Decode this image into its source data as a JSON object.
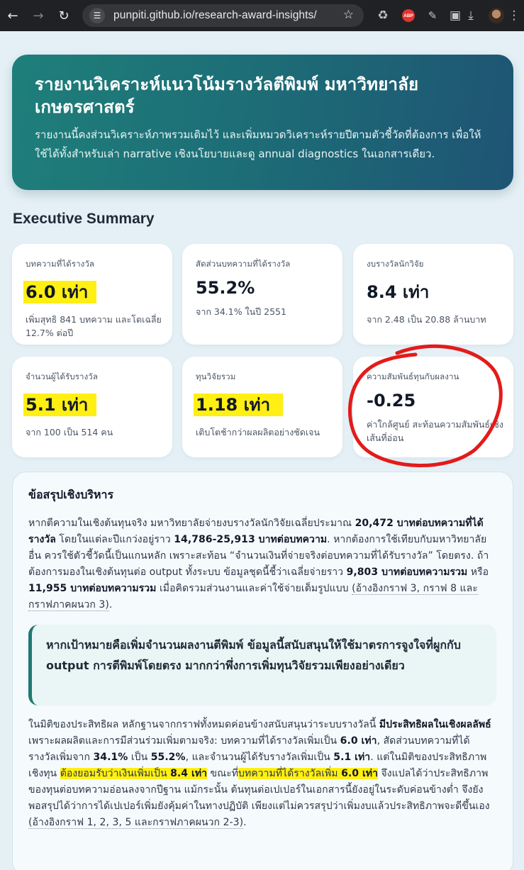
{
  "browser": {
    "url": "punpiti.github.io/research-award-insights/",
    "abp_badge": "ABP"
  },
  "hero": {
    "title": "รายงานวิเคราะห์แนวโน้มรางวัลตีพิมพ์ มหาวิทยาลัยเกษตรศาสตร์",
    "subtitle": "รายงานนี้คงส่วนวิเคราะห์ภาพรวมเดิมไว้ และเพิ่มหมวดวิเคราะห์รายปีตามตัวชี้วัดที่ต้องการ เพื่อให้ใช้ได้ทั้งสำหรับเล่า narrative เชิงนโยบายและดู annual diagnostics ในเอกสารเดียว."
  },
  "section_title": "Executive Summary",
  "cards": [
    {
      "label": "บทความที่ได้รางวัล",
      "value": "6.0 เท่า",
      "sub": "เพิ่มสุทธิ 841 บทความ และโตเฉลี่ย 12.7% ต่อปี",
      "highlighted": true
    },
    {
      "label": "สัดส่วนบทความที่ได้รางวัล",
      "value": "55.2%",
      "sub": "จาก 34.1% ในปี 2551",
      "highlighted": false
    },
    {
      "label": "งบรางวัลนักวิจัย",
      "value": "8.4 เท่า",
      "sub": "จาก 2.48 เป็น 20.88 ล้านบาท",
      "highlighted": false
    },
    {
      "label": "จำนวนผู้ได้รับรางวัล",
      "value": "5.1 เท่า",
      "sub": "จาก 100 เป็น 514 คน",
      "highlighted": true
    },
    {
      "label": "ทุนวิจัยรวม",
      "value": "1.18 เท่า",
      "sub": "เติบโตช้ากว่าผลผลิตอย่างชัดเจน",
      "highlighted": true
    },
    {
      "label": "ความสัมพันธ์ทุนกับผลงาน",
      "value": "-0.25",
      "sub": "ค่าใกล้ศูนย์ สะท้อนความสัมพันธ์เชิงเส้นที่อ่อน",
      "highlighted": false
    }
  ],
  "summary": {
    "heading": "ข้อสรุปเชิงบริหาร",
    "p1": {
      "a": "หากตีความในเชิงต้นทุนจริง มหาวิทยาลัยจ่ายงบรางวัลนักวิจัยเฉลี่ยประมาณ ",
      "b": "20,472 บาทต่อบทความที่ได้รางวัล",
      "c": " โดยในแต่ละปีแกว่งอยู่ราว ",
      "d": "14,786-25,913 บาทต่อบทความ",
      "e": ". หากต้องการใช้เทียบกับมหาวิทยาลัยอื่น ควรใช้ตัวชี้วัดนี้เป็นแกนหลัก เพราะสะท้อน “จำนวนเงินที่จ่ายจริงต่อบทความที่ได้รับรางวัล” โดยตรง. ถ้าต้องการมองในเชิงต้นทุนต่อ output ทั้งระบบ ข้อมูลชุดนี้ชี้ว่าเฉลี่ยจ่ายราว ",
      "f": "9,803 บาทต่อบทความรวม",
      "g": " หรือ ",
      "h": "11,955 บาทต่อบทความรวม",
      "i": " เมื่อคิดรวมส่วนงานและค่าใช้จ่ายเต็มรูปแบบ ",
      "ref": "(อ้างอิงกราฟ 3, กราฟ 8 และกราฟภาคผนวก 3)",
      "end": "."
    },
    "callout": "หากเป้าหมายคือเพิ่มจำนวนผลงานตีพิมพ์ ข้อมูลนี้สนับสนุนให้ใช้มาตรการจูงใจที่ผูกกับ output การตีพิมพ์โดยตรง มากกว่าพึ่งการเพิ่มทุนวิจัยรวมเพียงอย่างเดียว",
    "p2": {
      "a": "ในมิติของประสิทธิผล หลักฐานจากกราฟทั้งหมดค่อนข้างสนับสนุนว่าระบบรางวัลนี้ ",
      "b": "มีประสิทธิผลในเชิงผลลัพธ์",
      "c": " เพราะผลผลิตและการมีส่วนร่วมเพิ่มตามจริง: บทความที่ได้รางวัลเพิ่มเป็น ",
      "d": "6.0 เท่า",
      "e": ", สัดส่วนบทความที่ได้รางวัลเพิ่มจาก ",
      "f": "34.1%",
      "g": " เป็น ",
      "h": "55.2%",
      "i": ", และจำนวนผู้ได้รับรางวัลเพิ่มเป็น ",
      "j": "5.1 เท่า",
      "k": ". แต่ในมิติของประสิทธิภาพเชิงทุน ",
      "l": "ต้องยอมรับว่าเงินเพิ่มเป็น ",
      "m": "8.4 เท่า",
      "n": " ขณะที่",
      "o": "บทความที่ได้รางวัลเพิ่ม ",
      "p": "6.0 เท่า",
      "q": " จึงแปลได้ว่าประสิทธิภาพของทุนต่อบทความอ่อนลงจากปีฐาน แม้กระนั้น ต้นทุนต่อเปเปอร์ในเอกสารนี้ยังอยู่ในระดับค่อนข้างต่ำ จึงยังพอสรุปได้ว่าการได้เปเปอร์เพิ่มยังคุ้มค่าในทางปฏิบัติ เพียงแต่ไม่ควรสรุปว่าเพิ่มงบแล้วประสิทธิภาพจะดีขึ้นเอง ",
      "ref": "(อ้างอิงกราฟ 1, 2, 3, 5 และกราฟภาคผนวก 2-3)",
      "end": "."
    }
  },
  "colors": {
    "hero_start": "#1e7f7a",
    "hero_end": "#1e5474",
    "highlight": "#ffef12",
    "annotation_red": "#e31b1b"
  }
}
